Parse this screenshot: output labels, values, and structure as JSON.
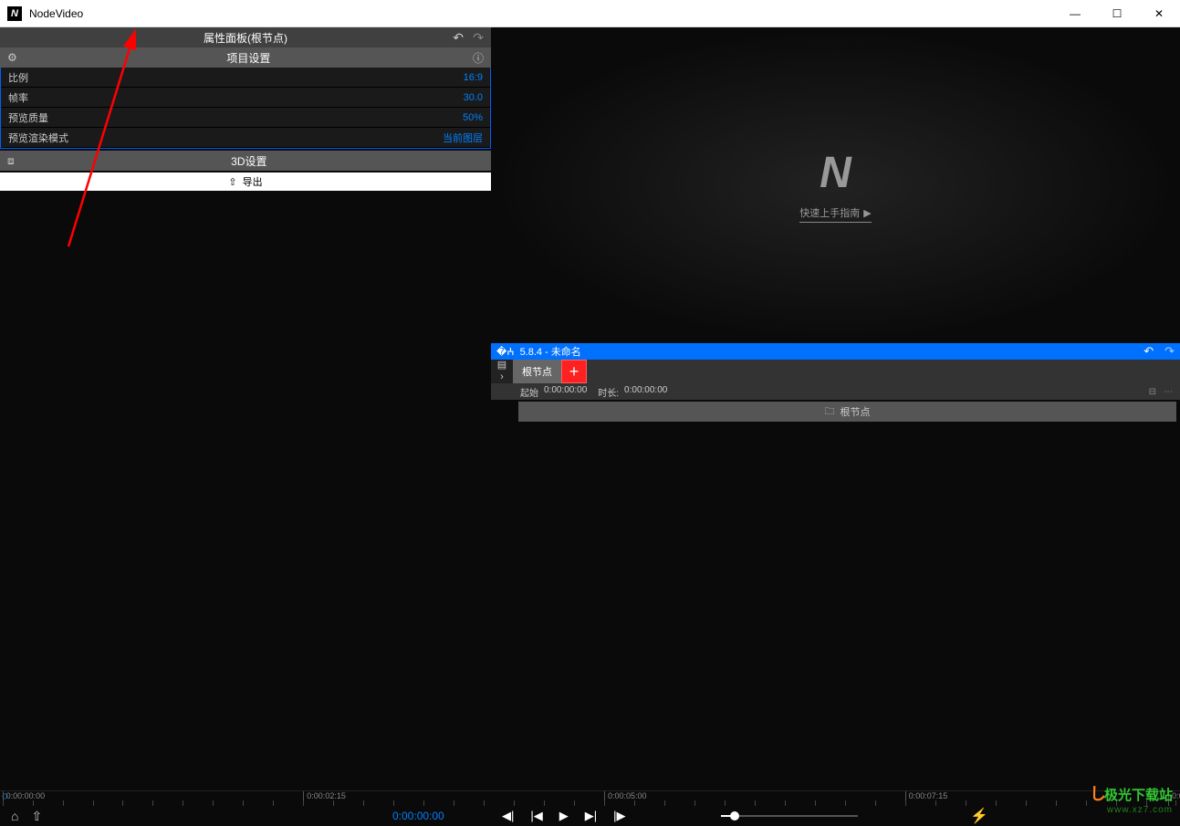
{
  "app": {
    "title": "NodeVideo"
  },
  "window_controls": {
    "min": "—",
    "max": "☐",
    "close": "✕"
  },
  "properties": {
    "panel_title": "属性面板(根节点)",
    "section_title": "项目设置",
    "rows": [
      {
        "label": "比例",
        "value": "16:9"
      },
      {
        "label": "帧率",
        "value": "30.0"
      },
      {
        "label": "预览质量",
        "value": "50%"
      },
      {
        "label": "预览渲染模式",
        "value": "当前图层"
      }
    ],
    "section_3d": "3D设置",
    "export_label": "导出"
  },
  "preview": {
    "guide_label": "快速上手指南"
  },
  "timeline": {
    "header_title": "5.8.4 - 未命名",
    "tab_label": "根节点",
    "start_label": "起始",
    "start_value": "0:00:00:00",
    "duration_label": "时长:",
    "duration_value": "0:00:00:00",
    "track_label": "根节点"
  },
  "ruler": {
    "major": [
      {
        "label": "0:00:00:00",
        "pct": 0.2
      },
      {
        "label": "0:00:02:15",
        "pct": 25.7
      },
      {
        "label": "0:00:05:00",
        "pct": 51.2
      },
      {
        "label": "0:00:07:15",
        "pct": 76.7
      }
    ],
    "partial_label": "0:0"
  },
  "controls": {
    "time": "0:00:00:00"
  },
  "watermark": {
    "top": "极光下载站",
    "bottom": "www.xz7.com"
  }
}
